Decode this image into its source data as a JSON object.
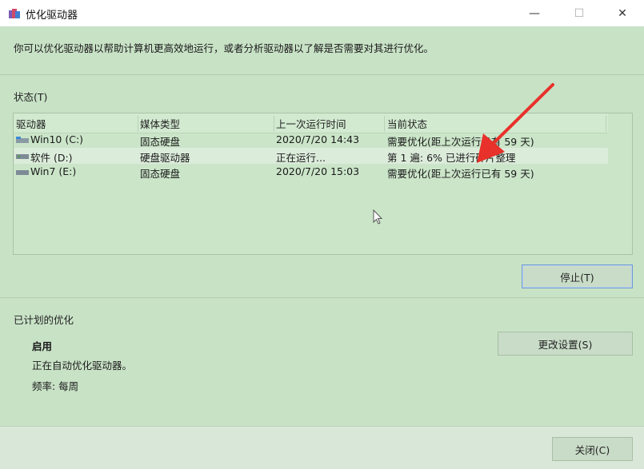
{
  "window": {
    "title": "优化驱动器",
    "minimize_glyph": "—",
    "maximize_glyph": "☐",
    "close_glyph": "✕"
  },
  "description": "你可以优化驱动器以帮助计算机更高效地运行，或者分析驱动器以了解是否需要对其进行优化。",
  "status_section": {
    "label": "状态(T)",
    "columns": [
      "驱动器",
      "媒体类型",
      "上一次运行时间",
      "当前状态"
    ],
    "drives": [
      {
        "name": "Win10 (C:)",
        "media": "固态硬盘",
        "last_run": "2020/7/20 14:43",
        "status": "需要优化(距上次运行已有 59 天)"
      },
      {
        "name": "软件 (D:)",
        "media": "硬盘驱动器",
        "last_run": "正在运行...",
        "status": "第 1 遍: 6% 已进行碎片整理"
      },
      {
        "name": "Win7 (E:)",
        "media": "固态硬盘",
        "last_run": "2020/7/20 15:03",
        "status": "需要优化(距上次运行已有 59 天)"
      }
    ],
    "stop_button": "停止(T)"
  },
  "scheduled": {
    "label": "已计划的优化",
    "state": "启用",
    "detail": "正在自动优化驱动器。",
    "frequency": "频率: 每周",
    "change_settings_button": "更改设置(S)"
  },
  "footer": {
    "close_button": "关闭(C)"
  },
  "colors": {
    "annotation_arrow": "#e8312a",
    "background": "#c8e2c6"
  }
}
